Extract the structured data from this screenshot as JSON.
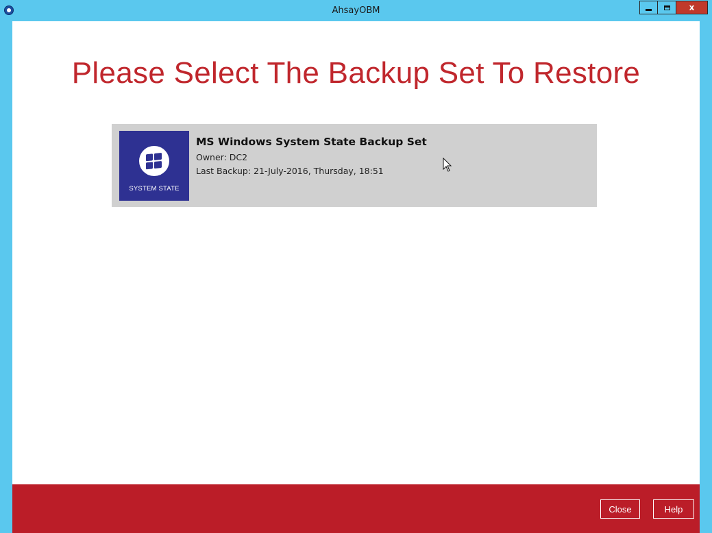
{
  "window": {
    "title": "AhsayOBM"
  },
  "main": {
    "heading": "Please Select The Backup Set To Restore"
  },
  "backup_sets": [
    {
      "name": "MS Windows System State Backup Set",
      "owner": "Owner: DC2",
      "last_backup": "Last Backup: 21-July-2016, Thursday, 18:51",
      "icon_label": "SYSTEM STATE",
      "icon": "windows-logo-icon"
    }
  ],
  "footer": {
    "close_label": "Close",
    "help_label": "Help"
  },
  "colors": {
    "titlebar": "#5ac8ee",
    "heading": "#c0272d",
    "footer": "#bb1d28",
    "icon_bg": "#2e3192",
    "card_bg": "#d0d0d0"
  }
}
